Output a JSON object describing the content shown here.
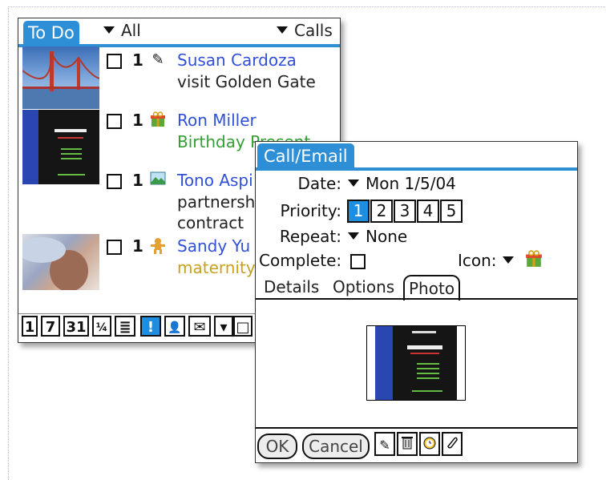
{
  "todo": {
    "title": "To Do",
    "filter_left": "All",
    "filter_right": "Calls",
    "items": [
      {
        "priority": "1",
        "icon": "pen-icon",
        "name": "Susan Cardoza",
        "note": "visit Golden Gate",
        "note_color": "#222222"
      },
      {
        "priority": "1",
        "icon": "gift-icon",
        "name": "Ron Miller",
        "note": "Birthday Present",
        "note_color": "#33a033"
      },
      {
        "priority": "1",
        "icon": "landscape-icon",
        "name": "Tono Aspi",
        "note": "partnersh",
        "note2": "contract",
        "note_color": "#222222"
      },
      {
        "priority": "1",
        "icon": "gingerbread-icon",
        "name": "Sandy Yu",
        "note": "maternity",
        "note_color": "#c8a020"
      }
    ],
    "toolbar": [
      "1",
      "7",
      "31",
      "¼",
      "≣",
      "!",
      "👤",
      "✉",
      "▾",
      "□"
    ]
  },
  "call": {
    "title": "Call/Email",
    "date_label": "Date:",
    "date_value": "Mon 1/5/04",
    "priority_label": "Priority:",
    "priorities": [
      "1",
      "2",
      "3",
      "4",
      "5"
    ],
    "priority_selected": "1",
    "repeat_label": "Repeat:",
    "repeat_value": "None",
    "complete_label": "Complete:",
    "icon_label": "Icon:",
    "tabs": [
      "Details",
      "Options",
      "Photo"
    ],
    "active_tab": "Photo",
    "ok": "OK",
    "cancel": "Cancel",
    "footer_icons": [
      "pen-icon",
      "trash-icon",
      "alarm-icon",
      "attach-icon"
    ]
  },
  "colors": {
    "accent": "#2f8fd6",
    "selection": "#1e8fe0",
    "link": "#3050d8"
  }
}
